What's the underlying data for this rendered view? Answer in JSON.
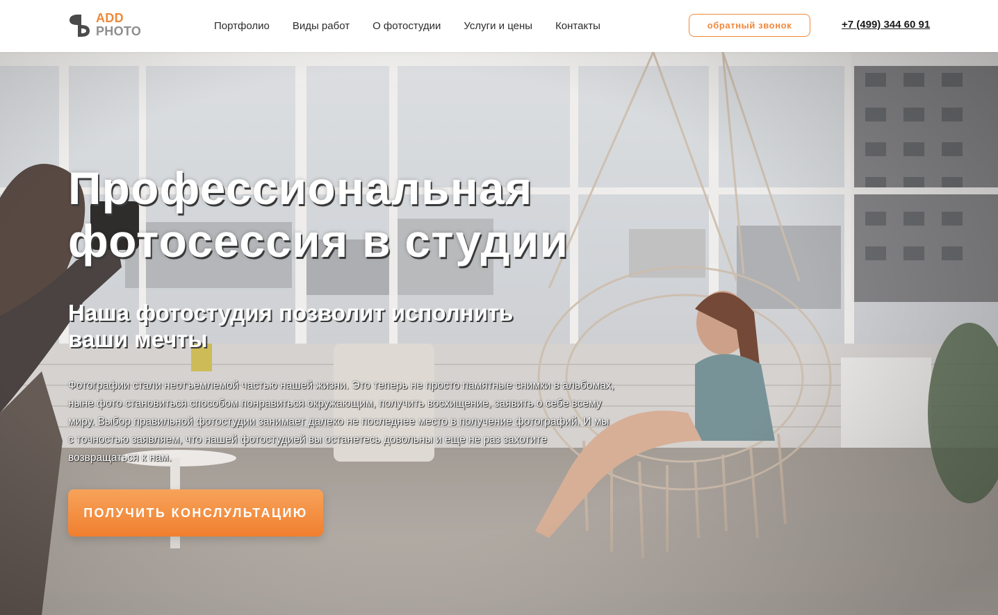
{
  "header": {
    "logo": {
      "line1": "ADD",
      "line2": "PHOTO"
    },
    "nav": [
      {
        "label": "Портфолио"
      },
      {
        "label": "Виды работ"
      },
      {
        "label": "О фотостудии"
      },
      {
        "label": "Услуги и цены"
      },
      {
        "label": "Контакты"
      }
    ],
    "callback_label": "обратный звонок",
    "phone": "+7 (499) 344 60 91"
  },
  "hero": {
    "title_line1": "Профессиональная",
    "title_line2": "фотосессия в студии",
    "subtitle_line1": "Наша фотостудия позволит исполнить",
    "subtitle_line2": "ваши мечты",
    "text": "Фотографии стали неотъемлемой частью нашей жизни. Это теперь не просто памятные снимки в альбомах, ныне фото становиться способом понравиться окружающим, получить восхищение, заявить о себе всему миру. Выбор правильной фотостудии занимает далеко не последнее место в получение фотографий. И мы с точностью заявляем, что нашей фотостудией вы останетесь довольны и еще не раз захотите возвращаться к нам.",
    "cta_label": "ПОЛУЧИТЬ КОНСЛУЛЬТАЦИЮ"
  },
  "colors": {
    "accent": "#f0883a",
    "logo_gray": "#8e8e8e",
    "header_bg": "#ffffff",
    "hero_text": "#ffffff"
  }
}
